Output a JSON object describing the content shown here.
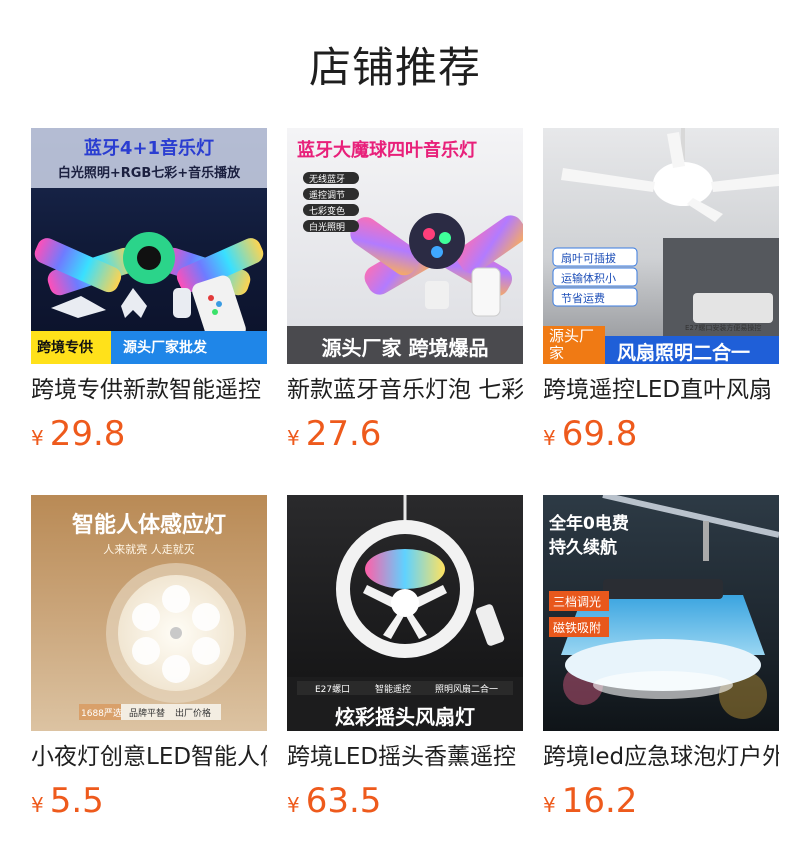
{
  "page": {
    "title": "店铺推荐"
  },
  "products": [
    {
      "name": "跨境专供新款智能遥控",
      "currency": "¥",
      "price": "29.8",
      "image_text": {
        "headline": "蓝牙4+1音乐灯",
        "subline": "白光照明+RGB七彩+音乐播放",
        "badge_left": "跨境专供",
        "badge_right": "源头厂家批发"
      }
    },
    {
      "name": "新款蓝牙音乐灯泡 七彩",
      "currency": "¥",
      "price": "27.6",
      "image_text": {
        "headline": "蓝牙大魔球四叶音乐灯",
        "features": [
          "无线蓝牙",
          "遥控调节",
          "七彩变色",
          "白光照明"
        ],
        "banner": "源头厂家 跨境爆品"
      }
    },
    {
      "name": "跨境遥控LED直叶风扇",
      "currency": "¥",
      "price": "69.8",
      "image_text": {
        "features": [
          "扇叶可插拔",
          "运输体积小",
          "节省运费"
        ],
        "badge": "源头厂家",
        "banner": "风扇照明二合一",
        "note": "E27螺口安装方便易操控"
      }
    },
    {
      "name": "小夜灯创意LED智能人体",
      "currency": "¥",
      "price": "5.5",
      "image_text": {
        "headline": "智能人体感应灯",
        "subline": "人来就亮 人走就灭",
        "badge_left": "1688严选",
        "badge_mid": "品牌平替",
        "badge_right": "出厂价格"
      }
    },
    {
      "name": "跨境LED摇头香薰遥控",
      "currency": "¥",
      "price": "63.5",
      "image_text": {
        "features": [
          "E27螺口",
          "智能遥控",
          "照明风扇二合一"
        ],
        "banner": "炫彩摇头风扇灯"
      }
    },
    {
      "name": "跨境led应急球泡灯户外",
      "currency": "¥",
      "price": "16.2",
      "image_text": {
        "headline": "全年0电费",
        "headline2": "持久续航",
        "tag1": "三档调光",
        "tag2": "磁铁吸附"
      }
    }
  ],
  "colors": {
    "price": "#ee5a1c",
    "title": "#1e1e1e"
  }
}
